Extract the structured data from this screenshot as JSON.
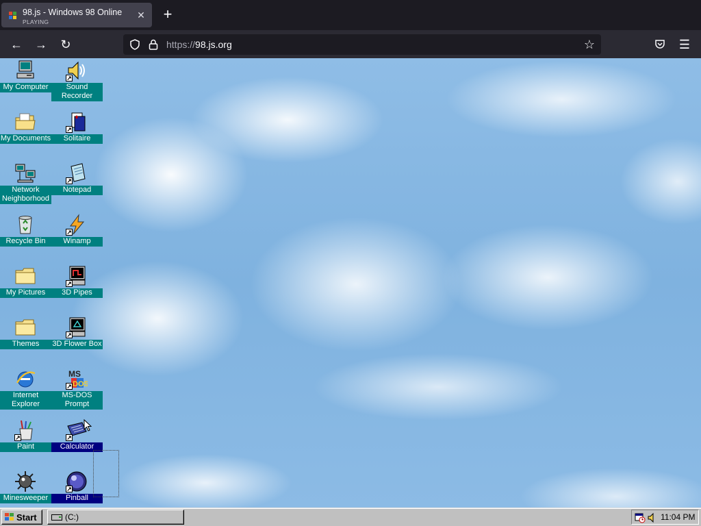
{
  "browser": {
    "tab": {
      "title": "98.js - Windows 98 Online",
      "status": "PLAYING",
      "close_icon": "close-icon"
    },
    "new_tab_icon": "plus-icon",
    "url": {
      "scheme": "https://",
      "host": "98.js.org"
    }
  },
  "desktop": {
    "icons": [
      {
        "label": "My Computer",
        "icon": "my-computer-icon"
      },
      {
        "label": "Sound Recorder",
        "icon": "sound-recorder-icon"
      },
      {
        "label": "My Documents",
        "icon": "my-documents-icon"
      },
      {
        "label": "Solitaire",
        "icon": "solitaire-icon"
      },
      {
        "label": "Network Neighborhood",
        "icon": "network-neighborhood-icon"
      },
      {
        "label": "Notepad",
        "icon": "notepad-icon"
      },
      {
        "label": "Recycle Bin",
        "icon": "recycle-bin-icon"
      },
      {
        "label": "Winamp",
        "icon": "winamp-icon"
      },
      {
        "label": "My Pictures",
        "icon": "folder-icon"
      },
      {
        "label": "3D Pipes",
        "icon": "3d-pipes-icon"
      },
      {
        "label": "Themes",
        "icon": "folder-icon"
      },
      {
        "label": "3D Flower Box",
        "icon": "3d-flower-box-icon"
      },
      {
        "label": "Internet Explorer",
        "icon": "internet-explorer-icon"
      },
      {
        "label": "MS-DOS Prompt",
        "icon": "ms-dos-prompt-icon"
      },
      {
        "label": "Paint",
        "icon": "paint-icon"
      },
      {
        "label": "Calculator",
        "icon": "calculator-icon",
        "selected": true
      },
      {
        "label": "Minesweeper",
        "icon": "minesweeper-icon"
      },
      {
        "label": "Pinball",
        "icon": "pinball-icon",
        "selected": true
      }
    ]
  },
  "taskbar": {
    "start_label": "Start",
    "task_label": "(C:)",
    "clock": "11:04 PM"
  },
  "colors": {
    "icon_label_bg": "#008080",
    "icon_label_selected_bg": "#000080",
    "taskbar": "#c0c0c0"
  }
}
